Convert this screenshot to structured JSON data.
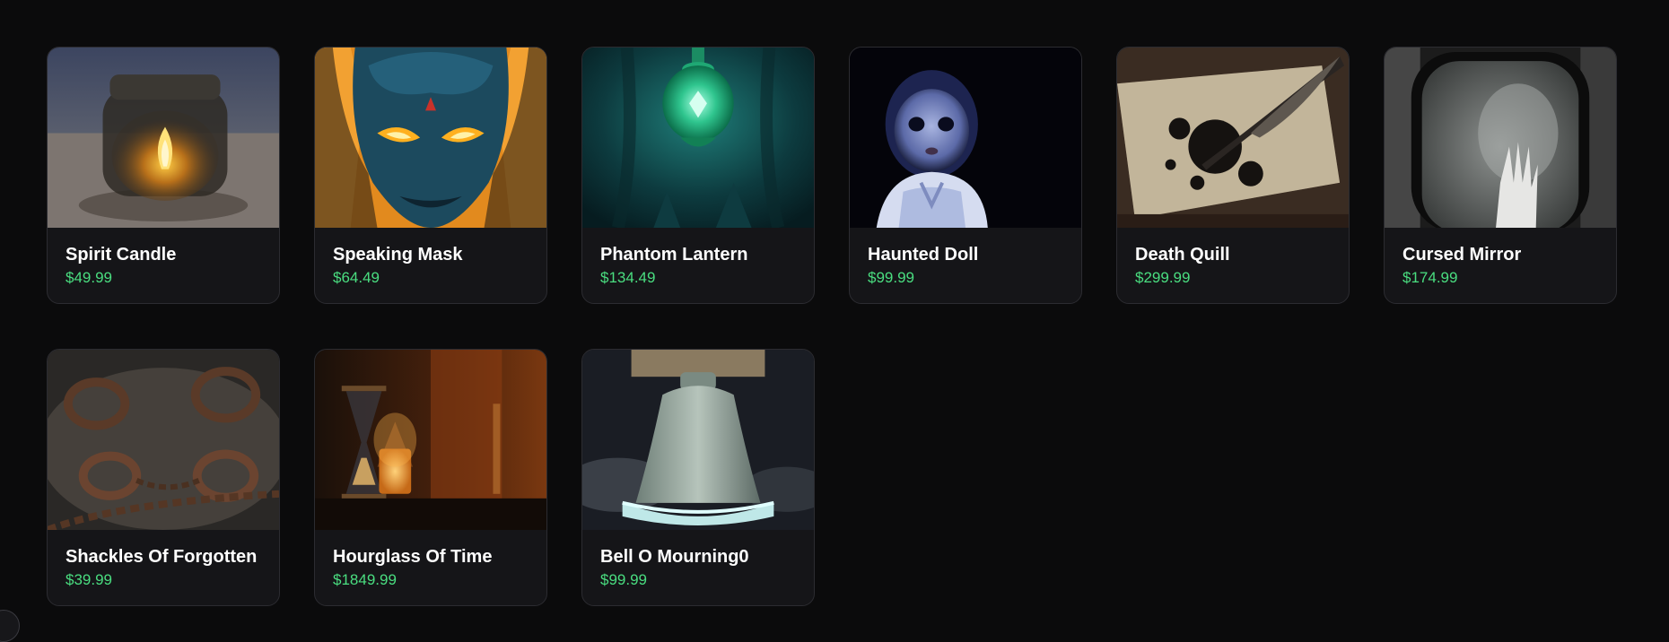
{
  "products": [
    {
      "name": "Spirit Candle",
      "price": "$49.99",
      "image": "candle-in-jar-image"
    },
    {
      "name": "Speaking Mask",
      "price": "$64.49",
      "image": "demon-mask-image"
    },
    {
      "name": "Phantom Lantern",
      "price": "$134.49",
      "image": "glowing-lantern-image"
    },
    {
      "name": "Haunted Doll",
      "price": "$99.99",
      "image": "porcelain-doll-image"
    },
    {
      "name": "Death Quill",
      "price": "$299.99",
      "image": "quill-and-ink-image"
    },
    {
      "name": "Cursed Mirror",
      "price": "$174.99",
      "image": "mirror-hand-image"
    },
    {
      "name": "Shackles Of Forgotten",
      "price": "$39.99",
      "image": "rusty-shackles-image"
    },
    {
      "name": "Hourglass Of Time",
      "price": "$1849.99",
      "image": "hourglass-candles-image"
    },
    {
      "name": "Bell O Mourning0",
      "price": "$99.99",
      "image": "bronze-bell-image"
    }
  ],
  "colors": {
    "background": "#0b0b0c",
    "card": "#151518",
    "price": "#4ade80"
  }
}
